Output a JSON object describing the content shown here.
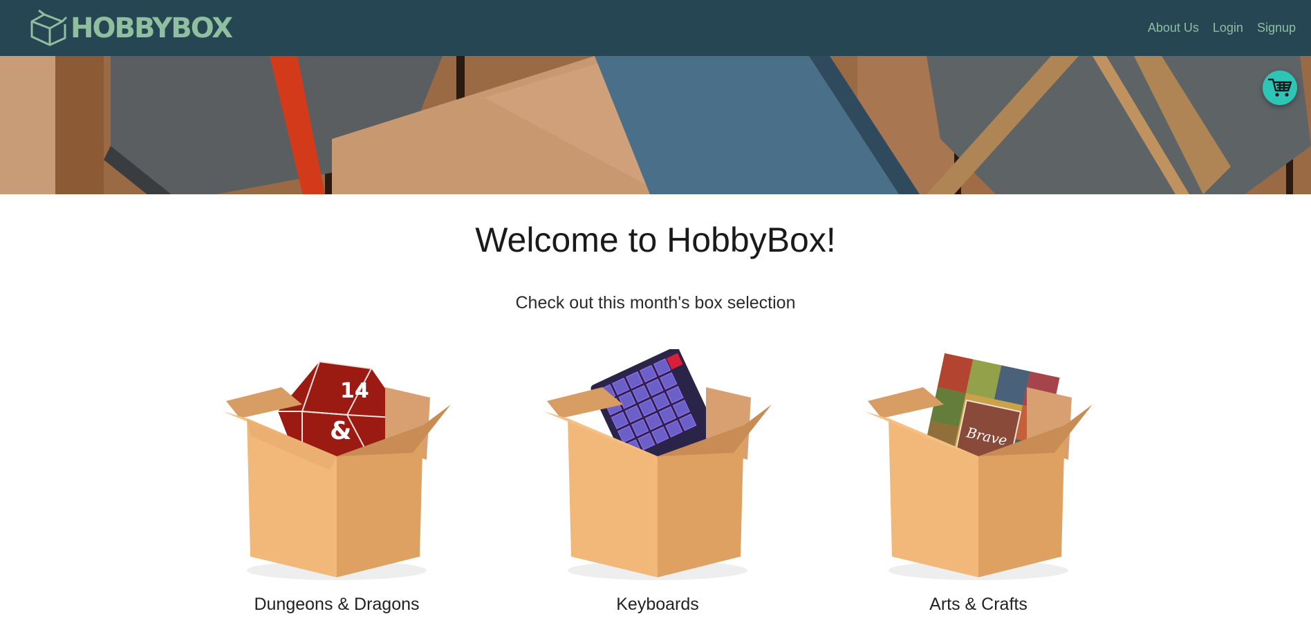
{
  "navbar": {
    "brand": "HOBBYBOX",
    "links": [
      "About Us",
      "Login",
      "Signup"
    ]
  },
  "hero": {
    "description_icon": "gift-boxes-banner"
  },
  "cart": {
    "icon": "shopping-cart-icon"
  },
  "main": {
    "title": "Welcome to HobbyBox!",
    "subtitle": "Check out this month's box selection"
  },
  "boxes": [
    {
      "label": "Dungeons & Dragons",
      "icon": "d20-dice-box-icon"
    },
    {
      "label": "Keyboards",
      "icon": "keyboard-box-icon"
    },
    {
      "label": "Arts & Crafts",
      "icon": "crafts-box-icon"
    }
  ],
  "colors": {
    "navbar": "#264653",
    "brand": "#8fbf9f",
    "cart": "#2ec4b6",
    "box": "#e8b47a"
  }
}
